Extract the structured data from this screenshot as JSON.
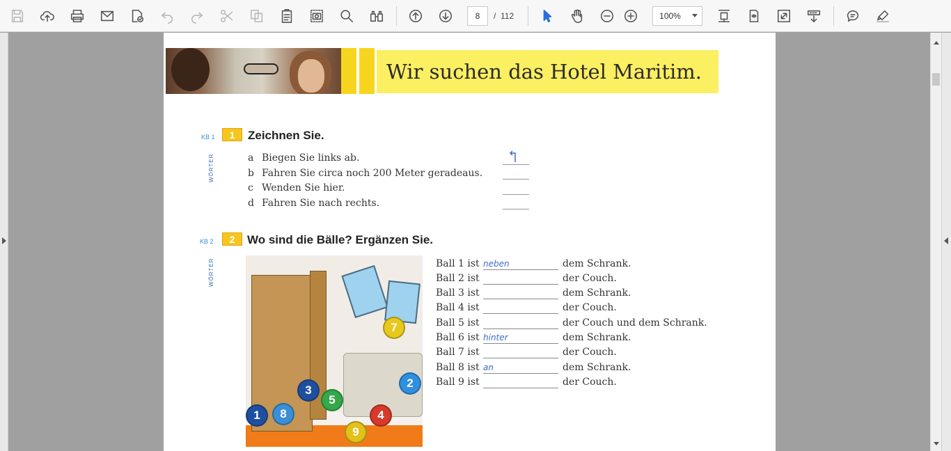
{
  "toolbar": {
    "buttons": [
      {
        "name": "save",
        "icon": "save-icon",
        "enabled": false
      },
      {
        "name": "upload",
        "icon": "cloud-upload-icon",
        "enabled": true
      },
      {
        "name": "print",
        "icon": "printer-icon",
        "enabled": true
      },
      {
        "name": "email",
        "icon": "envelope-icon",
        "enabled": true
      },
      {
        "name": "properties",
        "icon": "document-check-icon",
        "enabled": true
      },
      {
        "name": "undo",
        "icon": "undo-icon",
        "enabled": false
      },
      {
        "name": "redo",
        "icon": "redo-icon",
        "enabled": false
      },
      {
        "name": "cut",
        "icon": "scissors-icon",
        "enabled": false
      },
      {
        "name": "copy",
        "icon": "copy-icon",
        "enabled": false
      },
      {
        "name": "paste",
        "icon": "clipboard-icon",
        "enabled": true
      },
      {
        "name": "snapshot",
        "icon": "camera-icon",
        "enabled": true
      },
      {
        "name": "search",
        "icon": "search-icon",
        "enabled": true
      },
      {
        "name": "find",
        "icon": "binoculars-icon",
        "enabled": true
      }
    ],
    "page_current": "8",
    "page_separator": "/",
    "page_total": "112",
    "zoom": "100%",
    "accent": "#2a6fdb"
  },
  "document": {
    "banner_title": "Wir suchen das Hotel Maritim.",
    "task1": {
      "kb": "KB 1",
      "number": "1",
      "title": "Zeichnen Sie.",
      "side_label": "WÖRTER",
      "items": [
        {
          "letter": "a",
          "text": "Biegen Sie links ab."
        },
        {
          "letter": "b",
          "text": "Fahren Sie circa noch 200 Meter geradeaus."
        },
        {
          "letter": "c",
          "text": "Wenden Sie hier."
        },
        {
          "letter": "d",
          "text": "Fahren Sie nach rechts."
        }
      ],
      "example_answer": "turn-left-arrow-icon"
    },
    "task2": {
      "kb": "KB 2",
      "number": "2",
      "title": "Wo sind die Bälle? Ergänzen Sie.",
      "side_label": "WÖRTER",
      "balls_shown": [
        "7",
        "2",
        "5",
        "3",
        "1",
        "8",
        "4",
        "9"
      ],
      "sentences": [
        {
          "start": "Ball 1 ist",
          "answer": "neben",
          "end": "dem Schrank."
        },
        {
          "start": "Ball 2 ist",
          "answer": "",
          "end": "der Couch."
        },
        {
          "start": "Ball 3 ist",
          "answer": "",
          "end": "dem Schrank."
        },
        {
          "start": "Ball 4 ist",
          "answer": "",
          "end": "der Couch."
        },
        {
          "start": "Ball 5 ist",
          "answer": "",
          "end": "der Couch und dem Schrank."
        },
        {
          "start": "Ball 6 ist",
          "answer": "hinter",
          "end": "dem Schrank."
        },
        {
          "start": "Ball 7 ist",
          "answer": "",
          "end": "der Couch."
        },
        {
          "start": "Ball 8 ist",
          "answer": "an",
          "end": "dem Schrank."
        },
        {
          "start": "Ball 9 ist",
          "answer": "",
          "end": "der Couch."
        }
      ]
    }
  }
}
